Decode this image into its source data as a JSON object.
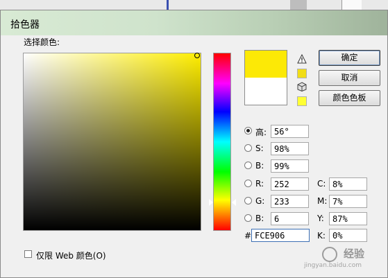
{
  "window": {
    "title": "拾色器"
  },
  "picker": {
    "label": "选择颜色:",
    "hue_deg": 56,
    "saturation_pct": 98,
    "brightness_pct": 99
  },
  "swatch": {
    "new_color": "#fce906",
    "old_color": "#ffffff"
  },
  "indicators": {
    "gamut_warning_color": "#f1dd16",
    "web_safe_color": "#ffff33"
  },
  "buttons": {
    "ok": "确定",
    "cancel": "取消",
    "swatches": "颜色色板"
  },
  "fields": {
    "hsb": [
      {
        "label": "高:",
        "value": "56°",
        "selected": true
      },
      {
        "label": "S:",
        "value": "98%",
        "selected": false
      },
      {
        "label": "B:",
        "value": "99%",
        "selected": false
      }
    ],
    "rgb": [
      {
        "label": "R:",
        "value": "252",
        "selected": false
      },
      {
        "label": "G:",
        "value": "233",
        "selected": false
      },
      {
        "label": "B:",
        "value": "6",
        "selected": false
      }
    ],
    "cmyk": [
      {
        "label": "C:",
        "value": "8%"
      },
      {
        "label": "M:",
        "value": "7%"
      },
      {
        "label": "Y:",
        "value": "87%"
      },
      {
        "label": "K:",
        "value": "0%"
      }
    ],
    "hex_label": "#",
    "hex_value": "FCE906"
  },
  "web_only": {
    "label": "仅限 Web 颜色(O)",
    "checked": false
  },
  "watermark": {
    "text": "经验",
    "url": "jingyan.baidu.com"
  }
}
